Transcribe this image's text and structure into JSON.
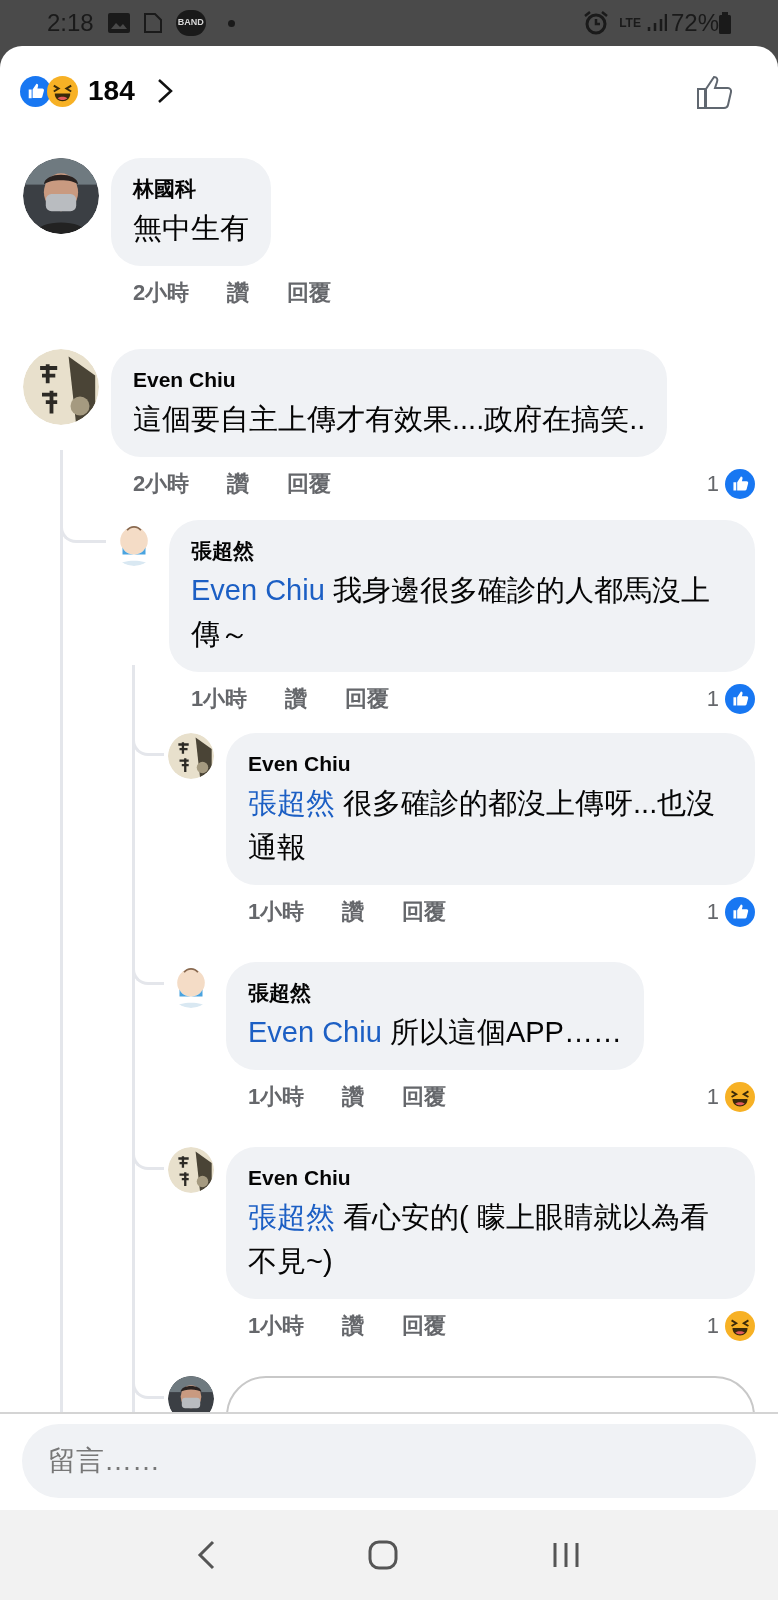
{
  "status_bar": {
    "time": "2:18",
    "app_badge": "BAND",
    "network": "LTE",
    "battery": "72%"
  },
  "header": {
    "reaction_count": "184"
  },
  "comments": [
    {
      "kind": "comment",
      "author": "林國科",
      "text": "無中生有",
      "time": "2小時",
      "like": "讚",
      "reply": "回覆"
    },
    {
      "kind": "comment",
      "avatar": {
        "kind": "scroll"
      },
      "author": "Even Chiu",
      "text": "這個要自主上傳才有效果....政府在搞笑..",
      "time": "2小時",
      "like": "讚",
      "reply": "回覆",
      "reaction": {
        "kind": "like",
        "count": "1"
      },
      "children": [
        {
          "kind": "comment",
          "avatar": {
            "kind": "cartoon"
          },
          "author": "張超然",
          "mention": "Even Chiu",
          "text": "我身邊很多確診的人都馬沒上傳～",
          "time": "1小時",
          "like": "讚",
          "reply": "回覆",
          "reaction": {
            "kind": "like",
            "count": "1"
          },
          "children": [
            {
              "kind": "comment",
              "avatar": {
                "kind": "scroll"
              },
              "author": "Even Chiu",
              "mention": "張超然",
              "text": "很多確診的都沒上傳呀...也沒通報",
              "time": "1小時",
              "like": "讚",
              "reply": "回覆",
              "reaction": {
                "kind": "like",
                "count": "1"
              }
            },
            {
              "kind": "comment",
              "avatar": {
                "kind": "cartoon"
              },
              "author": "張超然",
              "mention": "Even Chiu",
              "text": "所以這個APP……",
              "time": "1小時",
              "like": "讚",
              "reply": "回覆",
              "reaction": {
                "kind": "haha",
                "count": "1"
              }
            },
            {
              "kind": "comment",
              "avatar": {
                "kind": "scroll"
              },
              "author": "Even Chiu",
              "mention": "張超然",
              "text": "看心安的( 矇上眼睛就以為看不見~)",
              "time": "1小時",
              "like": "讚",
              "reply": "回覆",
              "reaction": {
                "kind": "haha",
                "count": "1"
              }
            },
            {
              "kind": "reply_input"
            }
          ]
        }
      ]
    }
  ],
  "composer": {
    "placeholder": "留言……"
  }
}
